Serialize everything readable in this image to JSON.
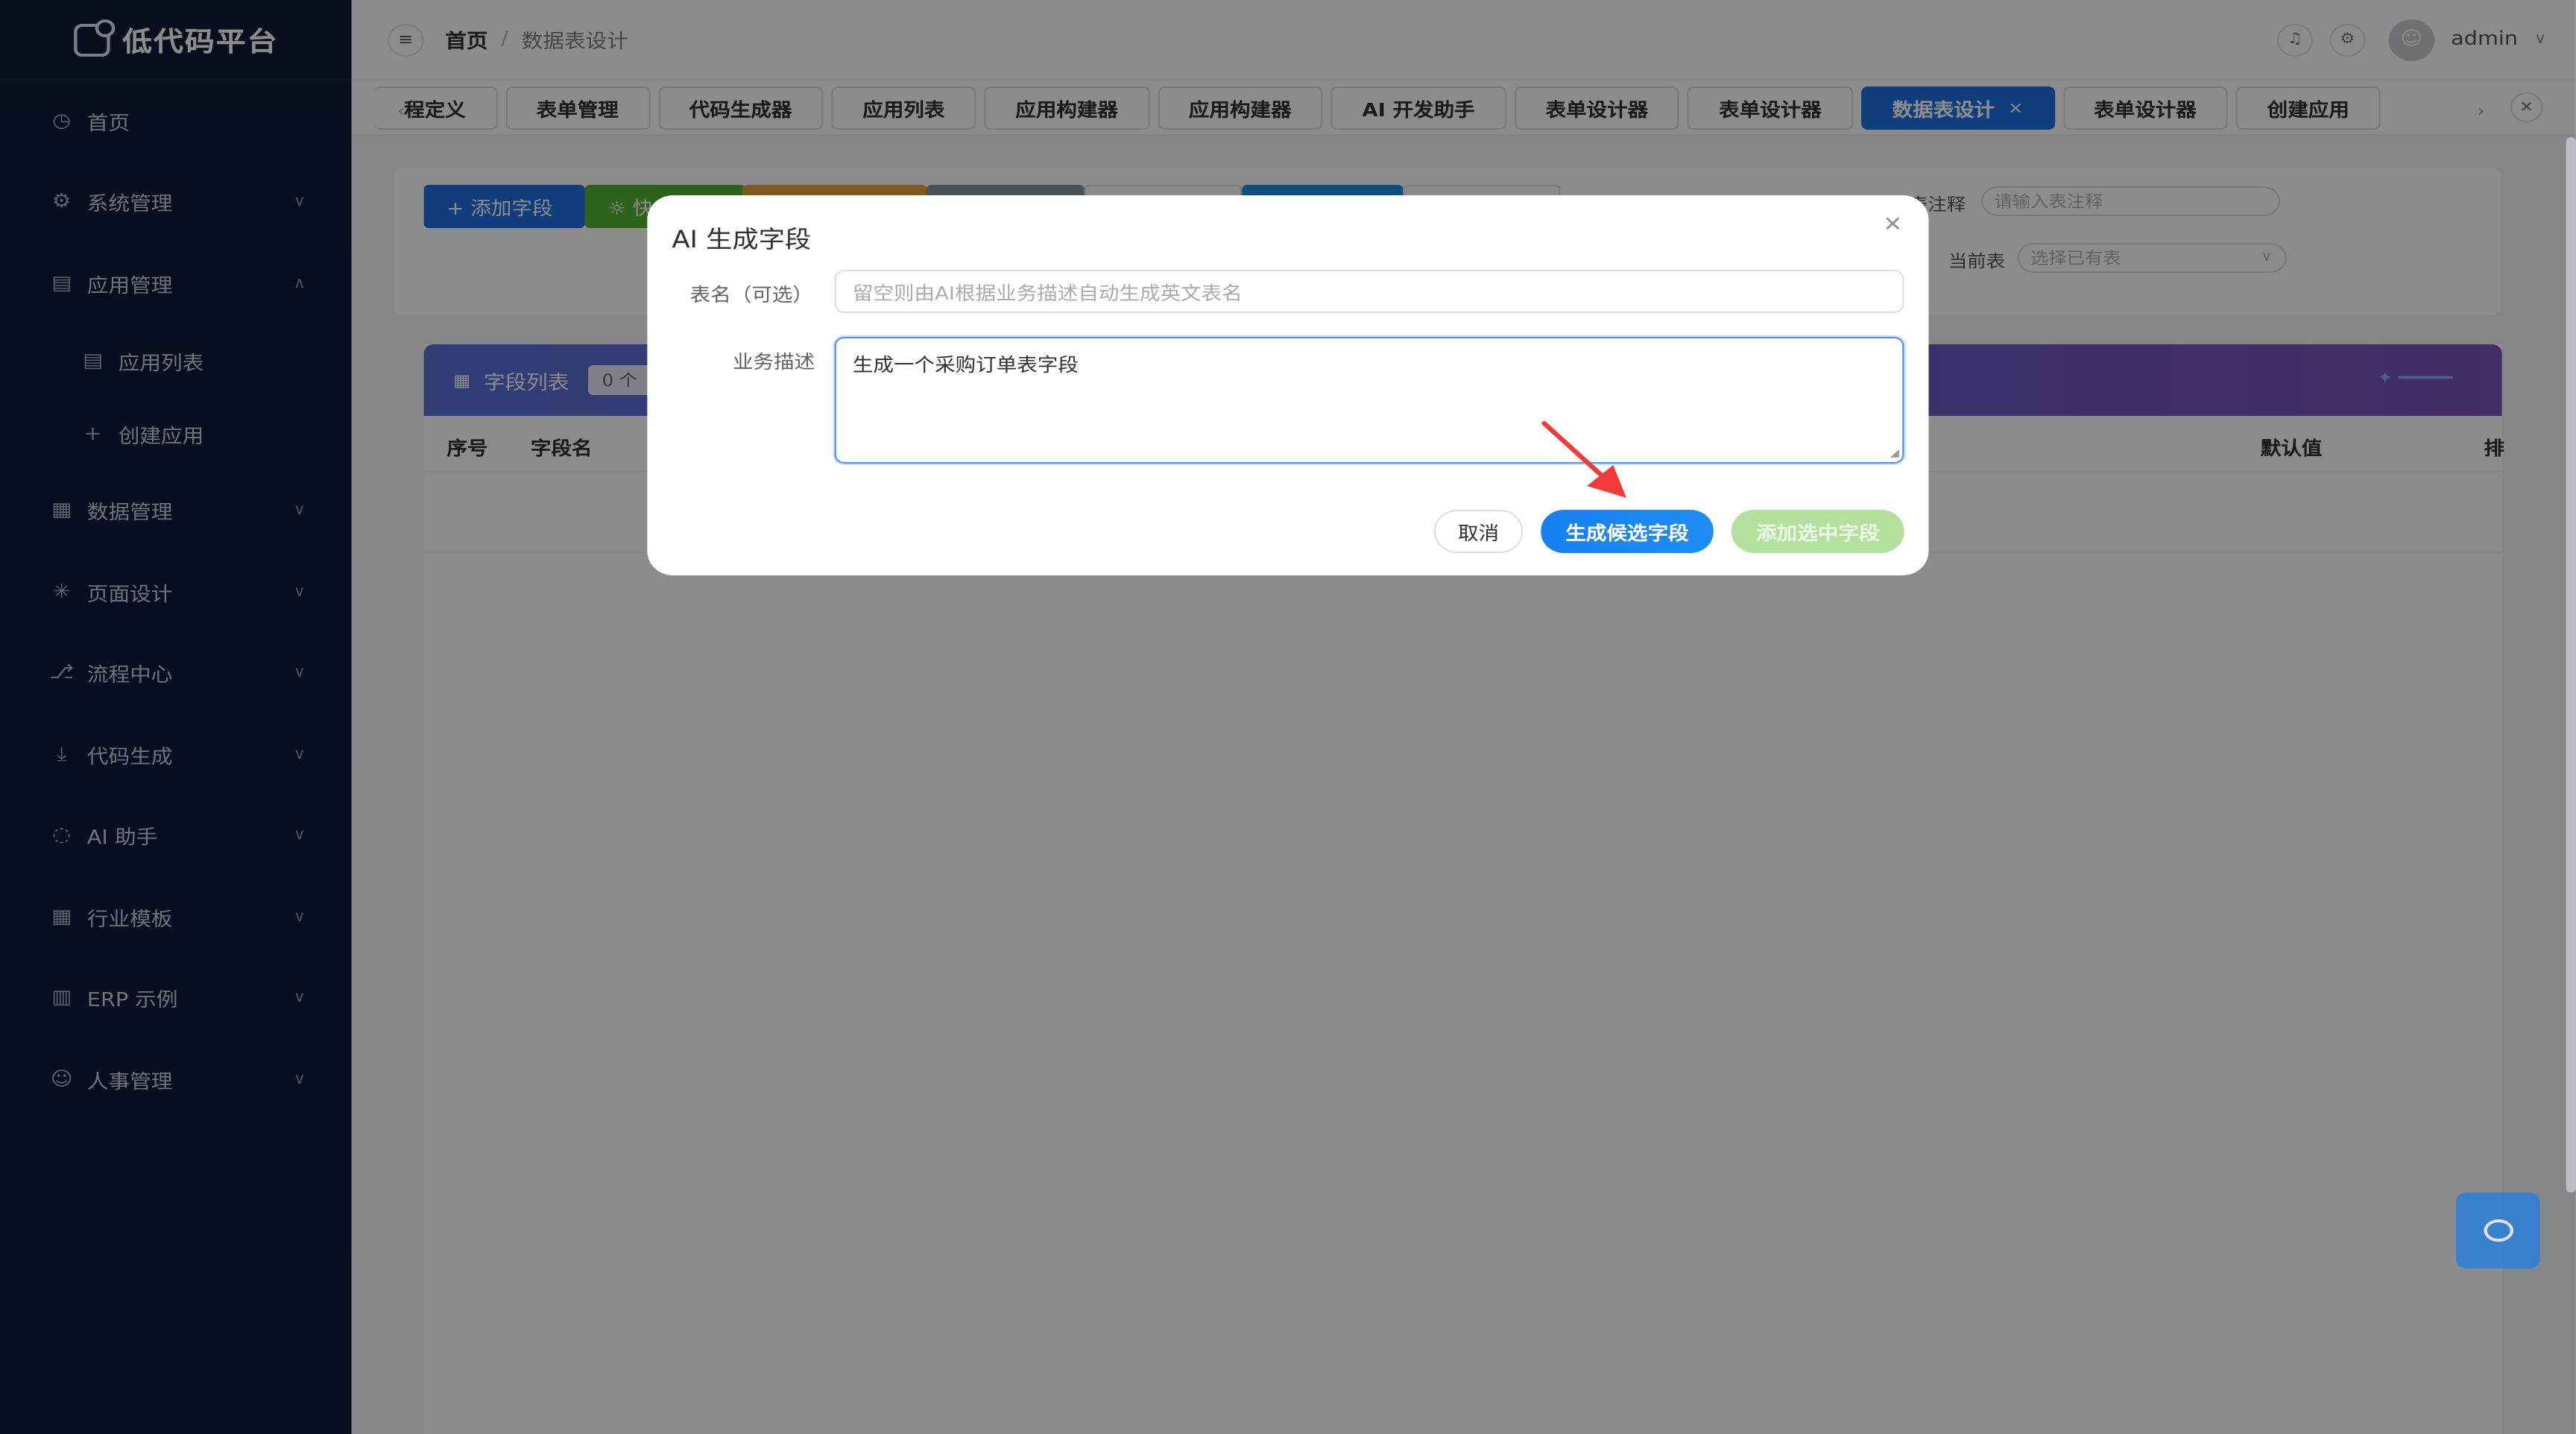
{
  "app": {
    "logo_text": "低代码平台"
  },
  "sidebar": {
    "items": [
      {
        "label": "首页",
        "icon": "dashboard-icon",
        "glyph": "◷"
      },
      {
        "label": "系统管理",
        "icon": "gear-icon",
        "glyph": "⚙"
      },
      {
        "label": "应用管理",
        "icon": "document-icon",
        "glyph": "▤"
      },
      {
        "label": "应用列表",
        "icon": "document-icon",
        "glyph": "▤"
      },
      {
        "label": "创建应用",
        "icon": "plus-icon",
        "glyph": "+"
      },
      {
        "label": "数据管理",
        "icon": "chart-board-icon",
        "glyph": "▦"
      },
      {
        "label": "页面设计",
        "icon": "sparkle-icon",
        "glyph": "✳"
      },
      {
        "label": "流程中心",
        "icon": "flow-icon",
        "glyph": "⎇"
      },
      {
        "label": "代码生成",
        "icon": "download-icon",
        "glyph": "⤓"
      },
      {
        "label": "AI 助手",
        "icon": "chat-icon",
        "glyph": "◌"
      },
      {
        "label": "行业模板",
        "icon": "grid-icon",
        "glyph": "▦"
      },
      {
        "label": "ERP 示例",
        "icon": "building-icon",
        "glyph": "▥"
      },
      {
        "label": "人事管理",
        "icon": "user-icon",
        "glyph": "☺"
      }
    ]
  },
  "header": {
    "breadcrumb_home": "首页",
    "breadcrumb_sep": "/",
    "breadcrumb_current": "数据表设计",
    "username": "admin"
  },
  "tabs": [
    {
      "label": "程定义"
    },
    {
      "label": "表单管理"
    },
    {
      "label": "代码生成器"
    },
    {
      "label": "应用列表"
    },
    {
      "label": "应用构建器"
    },
    {
      "label": "应用构建器"
    },
    {
      "label": "AI 开发助手"
    },
    {
      "label": "表单设计器"
    },
    {
      "label": "表单设计器"
    },
    {
      "label": "数据表设计",
      "close": "×"
    },
    {
      "label": "表单设计器"
    },
    {
      "label": "创建应用"
    }
  ],
  "toolbar": {
    "add_field": "+ 添加字段",
    "quick_prefix": "☼ 快",
    "table_comment_label": "表注释",
    "table_comment_placeholder": "请输入表注释",
    "current_table_label": "当前表",
    "current_table_placeholder": "选择已有表"
  },
  "field_list": {
    "title": "字段列表",
    "count": "0 个",
    "columns": [
      "序号",
      "字段名",
      "默认值",
      "排"
    ]
  },
  "dialog": {
    "title": "AI 生成字段",
    "table_name_label": "表名（可选）",
    "table_name_placeholder": "留空则由AI根据业务描述自动生成英文表名",
    "desc_label": "业务描述",
    "desc_value": "生成一个采购订单表字段",
    "cancel": "取消",
    "generate": "生成候选字段",
    "add_selected": "添加选中字段"
  },
  "colors": {
    "accent": "#1e6fe0",
    "annotation_arrow": "#f23a3a",
    "disabled_green": "#b3e19d"
  }
}
